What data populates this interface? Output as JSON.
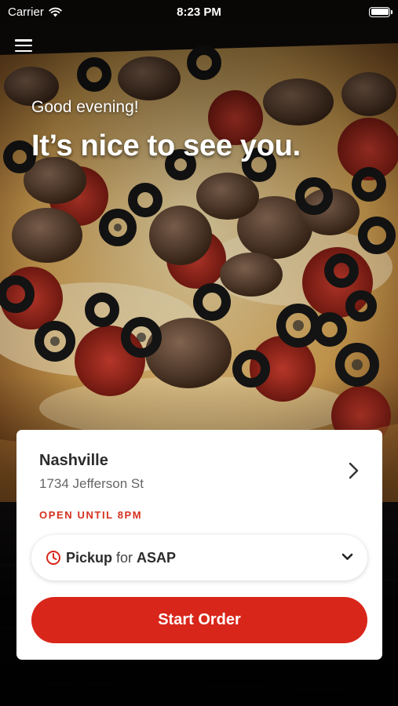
{
  "status_bar": {
    "carrier": "Carrier",
    "time": "8:23 PM",
    "wifi_icon": "wifi-icon",
    "battery_icon": "battery-icon",
    "battery_level": 1.0
  },
  "header": {
    "menu_icon": "hamburger-menu-icon"
  },
  "hero": {
    "greeting": "Good evening!",
    "headline": "It’s nice to see you.",
    "background": "pizza-photo"
  },
  "location_card": {
    "name": "Nashville",
    "address": "1734 Jefferson St",
    "hours": "OPEN UNTIL 8PM",
    "chevron_icon": "chevron-right-icon"
  },
  "order_options": {
    "clock_icon": "clock-icon",
    "mode": "Pickup",
    "connector": "for",
    "time": "ASAP",
    "dropdown_icon": "chevron-down-icon"
  },
  "actions": {
    "start_order_label": "Start Order"
  },
  "colors": {
    "accent_red": "#d9261a",
    "hours_red": "#d6301e",
    "card_bg": "#ffffff",
    "text_dark": "#2c2c2c"
  }
}
